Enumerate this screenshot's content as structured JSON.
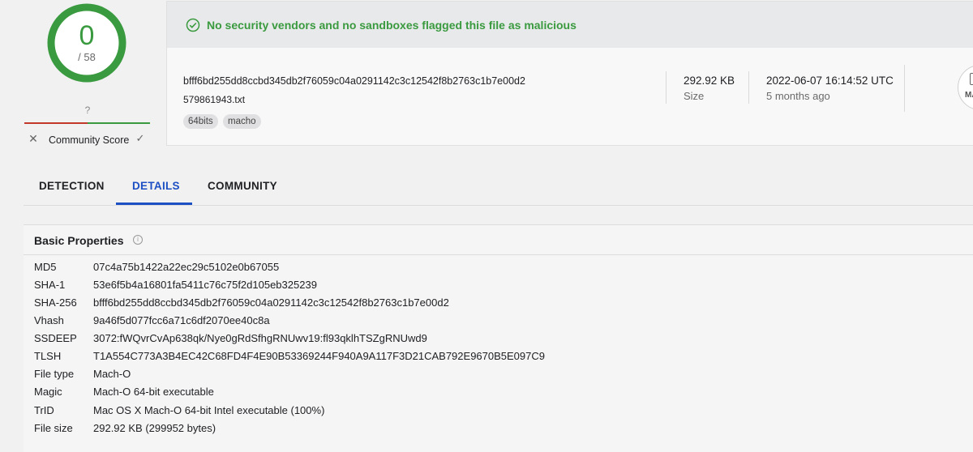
{
  "score": {
    "detections": "0",
    "total": "/ 58",
    "unknown_mark": "?"
  },
  "community": {
    "label": "Community Score"
  },
  "banner": {
    "text": "No security vendors and no sandboxes flagged this file as malicious"
  },
  "file": {
    "sha256": "bfff6bd255dd8ccbd345db2f76059c04a0291142c3c12542f8b2763c1b7e00d2",
    "name": "579861943.txt",
    "tags": [
      "64bits",
      "macho"
    ],
    "size_value": "292.92 KB",
    "size_label": "Size",
    "date_value": "2022-06-07 16:14:52 UTC",
    "date_ago": "5 months ago",
    "type_badge": "MA"
  },
  "tabs": [
    "DETECTION",
    "DETAILS",
    "COMMUNITY"
  ],
  "basic": {
    "title": "Basic Properties",
    "rows": [
      {
        "k": "MD5",
        "v": "07c4a75b1422a22ec29c5102e0b67055"
      },
      {
        "k": "SHA-1",
        "v": "53e6f5b4a16801fa5411c76c75f2d105eb325239"
      },
      {
        "k": "SHA-256",
        "v": "bfff6bd255dd8ccbd345db2f76059c04a0291142c3c12542f8b2763c1b7e00d2"
      },
      {
        "k": "Vhash",
        "v": "9a46f5d077fcc6a71c6df2070ee40c8a"
      },
      {
        "k": "SSDEEP",
        "v": "3072:fWQvrCvAp638qk/Nye0gRdSfhgRNUwv19:fl93qklhTSZgRNUwd9"
      },
      {
        "k": "TLSH",
        "v": "T1A554C773A3B4EC42C68FD4F4E90B53369244F940A9A117F3D21CAB792E9670B5E097C9"
      },
      {
        "k": "File type",
        "v": "Mach-O"
      },
      {
        "k": "Magic",
        "v": "Mach-O 64-bit executable"
      },
      {
        "k": "TrID",
        "v": "Mac OS X Mach-O 64-bit Intel executable (100%)"
      },
      {
        "k": "File size",
        "v": "292.92 KB (299952 bytes)"
      }
    ]
  },
  "colors": {
    "accent": "#1d4fc4",
    "clean": "#3a9a3f",
    "bad": "#c0392b"
  }
}
